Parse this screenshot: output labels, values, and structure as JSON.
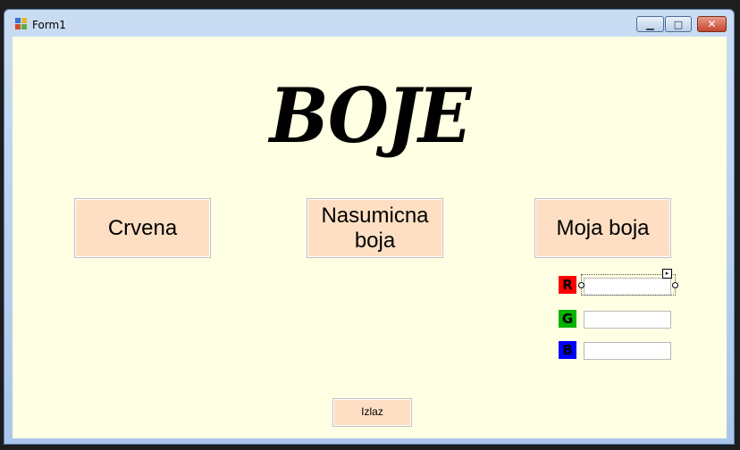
{
  "window": {
    "title": "Form1"
  },
  "controls": {
    "minimize_glyph": "▁",
    "maximize_glyph": "□",
    "close_glyph": "✕"
  },
  "form": {
    "heading": "BOJE",
    "buttons": {
      "red": "Crvena",
      "random": "Nasumicna boja",
      "mine": "Moja boja",
      "exit": "Izlaz"
    },
    "channels": {
      "r": {
        "label": "R",
        "value": "",
        "color": "#ff0000"
      },
      "g": {
        "label": "G",
        "value": "",
        "color": "#00b400"
      },
      "b": {
        "label": "B",
        "value": "",
        "color": "#0000ff"
      }
    },
    "background": "#ffffe3",
    "button_color": "#ffdfc3"
  }
}
